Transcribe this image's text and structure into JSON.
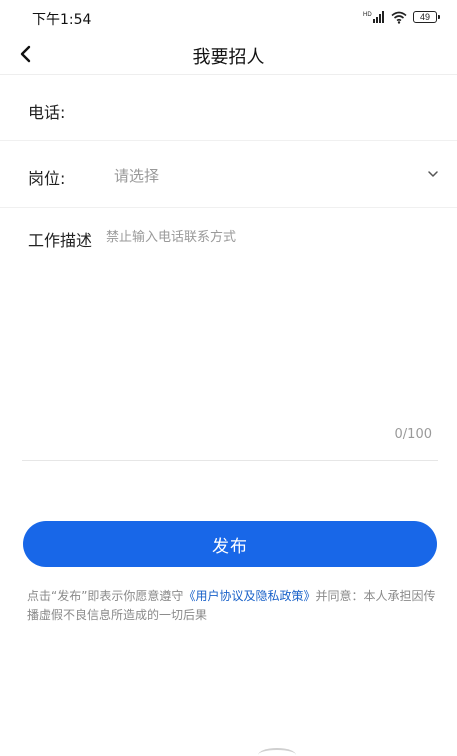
{
  "status_bar": {
    "time": "下午1:54",
    "network_label": "HD",
    "battery": "49"
  },
  "nav": {
    "title": "我要招人"
  },
  "form": {
    "phone": {
      "label": "电话:",
      "value": ""
    },
    "position": {
      "label": "岗位:",
      "placeholder": "请选择"
    },
    "description": {
      "label": "工作描述",
      "placeholder": "禁止输入电话联系方式",
      "counter": "0/100"
    }
  },
  "publish_button": {
    "label": "发布"
  },
  "agreement": {
    "prefix": "点击“发布”即表示你愿意遵守",
    "link": "《用户协议及隐私政策》",
    "suffix": "并同意：本人承担因传播虚假不良信息所造成的一切后果"
  },
  "colors": {
    "accent": "#1867e8",
    "link": "#1a62c9",
    "placeholder": "#999999"
  }
}
